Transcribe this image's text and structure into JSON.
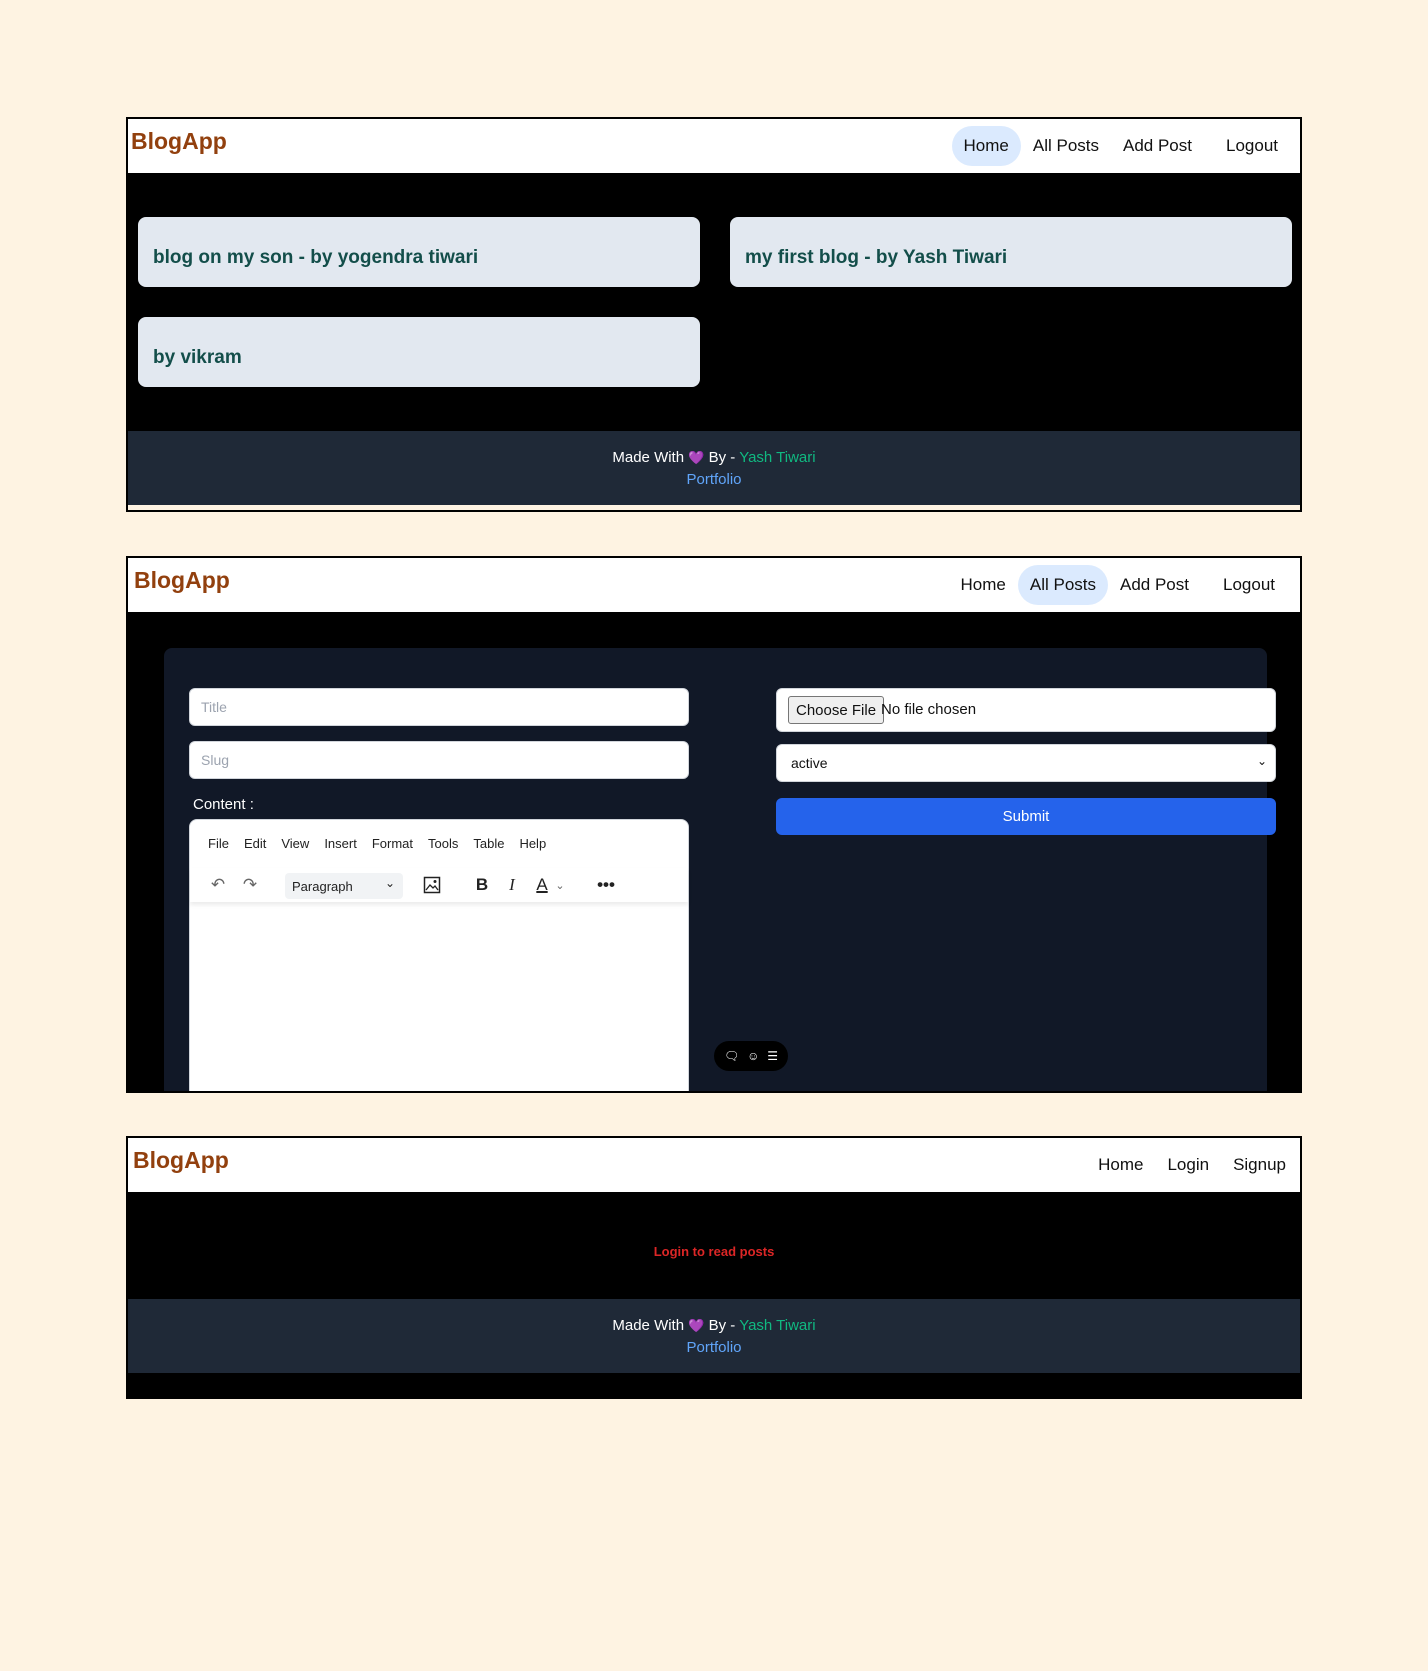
{
  "brand": "BlogApp",
  "screen1": {
    "nav": [
      {
        "label": "Home"
      },
      {
        "label": "All Posts"
      },
      {
        "label": "Add Post"
      },
      {
        "label": "Logout"
      }
    ],
    "active": "Home",
    "posts": [
      {
        "title": "blog on my son - by yogendra tiwari"
      },
      {
        "title": "my first blog - by Yash Tiwari"
      },
      {
        "title": "by vikram"
      }
    ]
  },
  "screen2": {
    "nav": [
      {
        "label": "Home"
      },
      {
        "label": "All Posts"
      },
      {
        "label": "Add Post"
      },
      {
        "label": "Logout"
      }
    ],
    "active": "All Posts",
    "form": {
      "title_placeholder": "Title",
      "slug_placeholder": "Slug",
      "content_label": "Content :",
      "editor_menu": [
        "File",
        "Edit",
        "View",
        "Insert",
        "Format",
        "Tools",
        "Table",
        "Help"
      ],
      "block_format": "Paragraph",
      "file_button": "Choose File",
      "file_status": "No file chosen",
      "status_value": "active",
      "submit_label": "Submit"
    }
  },
  "screen3": {
    "nav": [
      {
        "label": "Home"
      },
      {
        "label": "Login"
      },
      {
        "label": "Signup"
      }
    ],
    "message": "Login to read posts"
  },
  "footer": {
    "made_with": "Made With",
    "by": "By -",
    "author": "Yash Tiwari",
    "portfolio": "Portfolio"
  },
  "colors": {
    "background": "#fef3e2",
    "brand": "#92400e",
    "active_nav": "#dbeafe",
    "card": "#e2e8f0",
    "card_text": "#134e4a",
    "footer_bg": "#1f2937",
    "author": "#10b981",
    "link": "#60a5fa",
    "submit": "#2563eb",
    "error": "#dc2626"
  }
}
